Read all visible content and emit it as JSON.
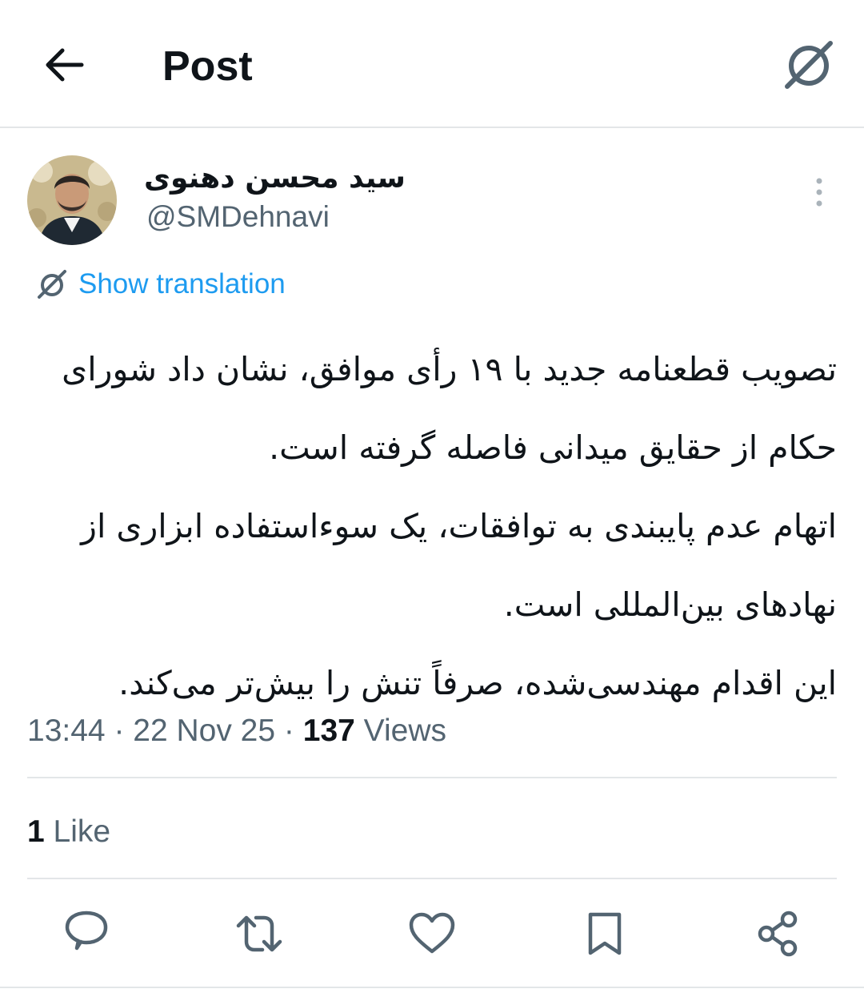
{
  "header": {
    "title": "Post",
    "back_icon": "arrow-left-icon",
    "grok_icon": "grok-icon"
  },
  "author": {
    "display_name": "سید محسن دهنوی",
    "handle": "@SMDehnavi"
  },
  "translation": {
    "label": "Show translation"
  },
  "post": {
    "lines": [
      "تصویب قطعنامه جدید با ۱۹ رأی موافق، نشان داد شورای",
      "حکام از حقایق میدانی فاصله گرفته است.",
      "اتهام عدم پایبندی به توافقات، یک سوءاستفاده ابزاری از",
      "نهادهای بین‌المللی است.",
      "این اقدام مهندسی‌شده، صرفاً تنش را بیش‌تر می‌کند."
    ]
  },
  "meta": {
    "time": "13:44",
    "separator": " · ",
    "date": "22 Nov 25",
    "views_count": "137",
    "views_label": " Views"
  },
  "engagement": {
    "likes_count": "1",
    "likes_label": " Like"
  },
  "actions": {
    "reply_icon": "reply-icon",
    "repost_icon": "repost-icon",
    "like_icon": "heart-icon",
    "bookmark_icon": "bookmark-icon",
    "share_icon": "share-icon"
  },
  "colors": {
    "accent": "#1d9bf0",
    "text": "#0f1419",
    "secondary": "#536471",
    "divider": "#e3e6e8"
  }
}
